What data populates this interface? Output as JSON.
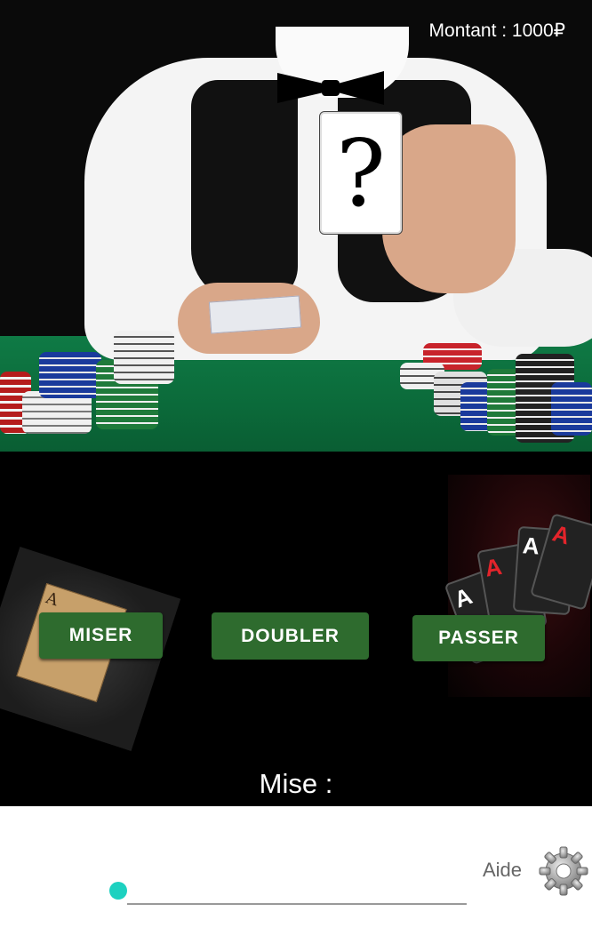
{
  "header": {
    "amount_text": "Montant : 1000₽"
  },
  "card": {
    "symbol": "?"
  },
  "actions": {
    "miser": "MISER",
    "doubler": "DOUBLER",
    "passer": "PASSER"
  },
  "bet": {
    "label": "Mise :",
    "slider_value": 0
  },
  "help": {
    "label": "Aide"
  },
  "icons": {
    "settings": "gear-icon"
  },
  "colors": {
    "button_green": "#2e6b2e",
    "slider_thumb": "#1dd1c0",
    "table_felt": "#0b6a3a"
  }
}
